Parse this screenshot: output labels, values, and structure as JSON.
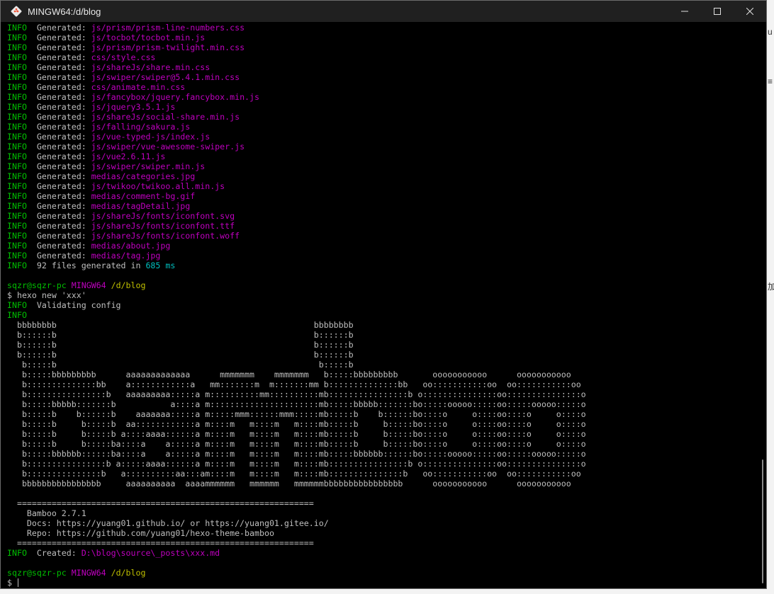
{
  "window": {
    "title": "MINGW64:/d/blog",
    "minimize_label": "",
    "maximize_label": "",
    "close_label": ""
  },
  "side_fragments": [
    "u",
    "≡",
    "加"
  ],
  "terminal": {
    "lines": [
      [
        {
          "t": "INFO",
          "c": "info"
        },
        {
          "t": "  Generated: ",
          "c": "white"
        },
        {
          "t": "js/prism/prism-line-numbers.css",
          "c": "mag"
        }
      ],
      [
        {
          "t": "INFO",
          "c": "info"
        },
        {
          "t": "  Generated: ",
          "c": "white"
        },
        {
          "t": "js/tocbot/tocbot.min.js",
          "c": "mag"
        }
      ],
      [
        {
          "t": "INFO",
          "c": "info"
        },
        {
          "t": "  Generated: ",
          "c": "white"
        },
        {
          "t": "js/prism/prism-twilight.min.css",
          "c": "mag"
        }
      ],
      [
        {
          "t": "INFO",
          "c": "info"
        },
        {
          "t": "  Generated: ",
          "c": "white"
        },
        {
          "t": "css/style.css",
          "c": "mag"
        }
      ],
      [
        {
          "t": "INFO",
          "c": "info"
        },
        {
          "t": "  Generated: ",
          "c": "white"
        },
        {
          "t": "js/shareJs/share.min.css",
          "c": "mag"
        }
      ],
      [
        {
          "t": "INFO",
          "c": "info"
        },
        {
          "t": "  Generated: ",
          "c": "white"
        },
        {
          "t": "js/swiper/swiper@5.4.1.min.css",
          "c": "mag"
        }
      ],
      [
        {
          "t": "INFO",
          "c": "info"
        },
        {
          "t": "  Generated: ",
          "c": "white"
        },
        {
          "t": "css/animate.min.css",
          "c": "mag"
        }
      ],
      [
        {
          "t": "INFO",
          "c": "info"
        },
        {
          "t": "  Generated: ",
          "c": "white"
        },
        {
          "t": "js/fancybox/jquery.fancybox.min.js",
          "c": "mag"
        }
      ],
      [
        {
          "t": "INFO",
          "c": "info"
        },
        {
          "t": "  Generated: ",
          "c": "white"
        },
        {
          "t": "js/jquery3.5.1.js",
          "c": "mag"
        }
      ],
      [
        {
          "t": "INFO",
          "c": "info"
        },
        {
          "t": "  Generated: ",
          "c": "white"
        },
        {
          "t": "js/shareJs/social-share.min.js",
          "c": "mag"
        }
      ],
      [
        {
          "t": "INFO",
          "c": "info"
        },
        {
          "t": "  Generated: ",
          "c": "white"
        },
        {
          "t": "js/falling/sakura.js",
          "c": "mag"
        }
      ],
      [
        {
          "t": "INFO",
          "c": "info"
        },
        {
          "t": "  Generated: ",
          "c": "white"
        },
        {
          "t": "js/vue-typed-js/index.js",
          "c": "mag"
        }
      ],
      [
        {
          "t": "INFO",
          "c": "info"
        },
        {
          "t": "  Generated: ",
          "c": "white"
        },
        {
          "t": "js/swiper/vue-awesome-swiper.js",
          "c": "mag"
        }
      ],
      [
        {
          "t": "INFO",
          "c": "info"
        },
        {
          "t": "  Generated: ",
          "c": "white"
        },
        {
          "t": "js/vue2.6.11.js",
          "c": "mag"
        }
      ],
      [
        {
          "t": "INFO",
          "c": "info"
        },
        {
          "t": "  Generated: ",
          "c": "white"
        },
        {
          "t": "js/swiper/swiper.min.js",
          "c": "mag"
        }
      ],
      [
        {
          "t": "INFO",
          "c": "info"
        },
        {
          "t": "  Generated: ",
          "c": "white"
        },
        {
          "t": "medias/categories.jpg",
          "c": "mag"
        }
      ],
      [
        {
          "t": "INFO",
          "c": "info"
        },
        {
          "t": "  Generated: ",
          "c": "white"
        },
        {
          "t": "js/twikoo/twikoo.all.min.js",
          "c": "mag"
        }
      ],
      [
        {
          "t": "INFO",
          "c": "info"
        },
        {
          "t": "  Generated: ",
          "c": "white"
        },
        {
          "t": "medias/comment-bg.gif",
          "c": "mag"
        }
      ],
      [
        {
          "t": "INFO",
          "c": "info"
        },
        {
          "t": "  Generated: ",
          "c": "white"
        },
        {
          "t": "medias/tagDetail.jpg",
          "c": "mag"
        }
      ],
      [
        {
          "t": "INFO",
          "c": "info"
        },
        {
          "t": "  Generated: ",
          "c": "white"
        },
        {
          "t": "js/shareJs/fonts/iconfont.svg",
          "c": "mag"
        }
      ],
      [
        {
          "t": "INFO",
          "c": "info"
        },
        {
          "t": "  Generated: ",
          "c": "white"
        },
        {
          "t": "js/shareJs/fonts/iconfont.ttf",
          "c": "mag"
        }
      ],
      [
        {
          "t": "INFO",
          "c": "info"
        },
        {
          "t": "  Generated: ",
          "c": "white"
        },
        {
          "t": "js/shareJs/fonts/iconfont.woff",
          "c": "mag"
        }
      ],
      [
        {
          "t": "INFO",
          "c": "info"
        },
        {
          "t": "  Generated: ",
          "c": "white"
        },
        {
          "t": "medias/about.jpg",
          "c": "mag"
        }
      ],
      [
        {
          "t": "INFO",
          "c": "info"
        },
        {
          "t": "  Generated: ",
          "c": "white"
        },
        {
          "t": "medias/tag.jpg",
          "c": "mag"
        }
      ],
      [
        {
          "t": "INFO",
          "c": "info"
        },
        {
          "t": "  92 files generated in ",
          "c": "white"
        },
        {
          "t": "685 ms",
          "c": "cyan"
        }
      ],
      [],
      [
        {
          "t": "sqzr@sqzr-pc ",
          "c": "green"
        },
        {
          "t": "MINGW64 ",
          "c": "mag"
        },
        {
          "t": "/d/blog",
          "c": "yellow"
        }
      ],
      [
        {
          "t": "$ hexo new 'xxx'",
          "c": "white"
        }
      ],
      [
        {
          "t": "INFO",
          "c": "info"
        },
        {
          "t": "  Validating config",
          "c": "white"
        }
      ],
      [
        {
          "t": "INFO",
          "c": "info"
        }
      ],
      [
        {
          "t": "  bbbbbbbb                                                    bbbbbbbb",
          "c": "white"
        }
      ],
      [
        {
          "t": "  b::::::b                                                    b::::::b",
          "c": "white"
        }
      ],
      [
        {
          "t": "  b::::::b                                                    b::::::b",
          "c": "white"
        }
      ],
      [
        {
          "t": "  b::::::b                                                    b::::::b",
          "c": "white"
        }
      ],
      [
        {
          "t": "   b:::::b                                                     b:::::b",
          "c": "white"
        }
      ],
      [
        {
          "t": "   b:::::bbbbbbbbb      aaaaaaaaaaaaa      mmmmmmm    mmmmmmm   b:::::bbbbbbbbb       ooooooooooo      ooooooooooo",
          "c": "white"
        }
      ],
      [
        {
          "t": "   b::::::::::::::bb    a::::::::::::a   mm:::::::m  m:::::::mm b::::::::::::::bb   oo:::::::::::oo  oo:::::::::::oo",
          "c": "white"
        }
      ],
      [
        {
          "t": "   b::::::::::::::::b   aaaaaaaaa:::::a m::::::::::mm::::::::::mb::::::::::::::::b o:::::::::::::::oo:::::::::::::::o",
          "c": "white"
        }
      ],
      [
        {
          "t": "   b:::::bbbbb:::::::b           a::::a m::::::::::::::::::::::mb:::::bbbbb:::::::bo:::::ooooo:::::oo:::::ooooo:::::o",
          "c": "white"
        }
      ],
      [
        {
          "t": "   b:::::b    b::::::b    aaaaaaa:::::a m:::::mmm::::::mmm:::::mb:::::b    b::::::bo::::o     o::::oo::::o     o::::o",
          "c": "white"
        }
      ],
      [
        {
          "t": "   b:::::b     b:::::b  aa::::::::::::a m::::m   m::::m   m::::mb:::::b     b:::::bo::::o     o::::oo::::o     o::::o",
          "c": "white"
        }
      ],
      [
        {
          "t": "   b:::::b     b:::::b a::::aaaa::::::a m::::m   m::::m   m::::mb:::::b     b:::::bo::::o     o::::oo::::o     o::::o",
          "c": "white"
        }
      ],
      [
        {
          "t": "   b:::::b     b:::::ba::::a    a:::::a m::::m   m::::m   m::::mb:::::b     b:::::bo::::o     o::::oo::::o     o::::o",
          "c": "white"
        }
      ],
      [
        {
          "t": "   b:::::bbbbbb::::::ba::::a    a:::::a m::::m   m::::m   m::::mb:::::bbbbbb::::::bo:::::ooooo:::::oo:::::ooooo:::::o",
          "c": "white"
        }
      ],
      [
        {
          "t": "   b::::::::::::::::b a:::::aaaa::::::a m::::m   m::::m   m::::mb::::::::::::::::b o:::::::::::::::oo:::::::::::::::o",
          "c": "white"
        }
      ],
      [
        {
          "t": "   b:::::::::::::::b   a::::::::::aa:::am::::m   m::::m   m::::mb:::::::::::::::b   oo:::::::::::oo  oo:::::::::::oo",
          "c": "white"
        }
      ],
      [
        {
          "t": "   bbbbbbbbbbbbbbbb     aaaaaaaaaa  aaaammmmmm   mmmmmm   mmmmmmbbbbbbbbbbbbbbbb      ooooooooooo      ooooooooooo",
          "c": "white"
        }
      ],
      [],
      [
        {
          "t": "  ============================================================",
          "c": "white"
        }
      ],
      [
        {
          "t": "    Bamboo 2.7.1",
          "c": "white"
        }
      ],
      [
        {
          "t": "    Docs: https://yuang01.github.io/ or https://yuang01.gitee.io/",
          "c": "white"
        }
      ],
      [
        {
          "t": "    Repo: https://github.com/yuang01/hexo-theme-bamboo",
          "c": "white"
        }
      ],
      [
        {
          "t": "  ============================================================",
          "c": "white"
        }
      ],
      [
        {
          "t": "INFO",
          "c": "info"
        },
        {
          "t": "  Created: ",
          "c": "white"
        },
        {
          "t": "D:\\blog\\source\\_posts\\xxx.md",
          "c": "mag"
        }
      ],
      [],
      [
        {
          "t": "sqzr@sqzr-pc ",
          "c": "green"
        },
        {
          "t": "MINGW64 ",
          "c": "mag"
        },
        {
          "t": "/d/blog",
          "c": "yellow"
        }
      ],
      [
        {
          "t": "$ ",
          "c": "white"
        }
      ]
    ]
  }
}
